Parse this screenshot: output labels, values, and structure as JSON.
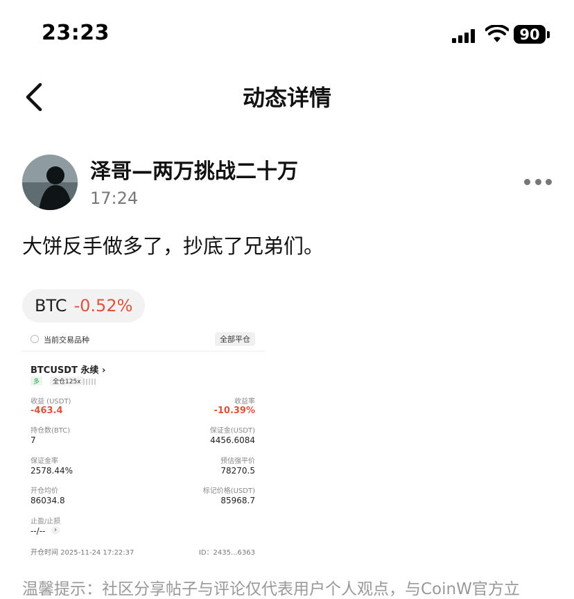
{
  "status_bar": {
    "time": "23:23",
    "battery": "90"
  },
  "nav": {
    "title": "动态详情"
  },
  "post": {
    "author": "泽哥—两万挑战二十万",
    "time": "17:24",
    "content": "大饼反手做多了，抄底了兄弟们。",
    "ticker": {
      "symbol": "BTC",
      "change": "-0.52%"
    }
  },
  "screenshot": {
    "label": "当前交易品种",
    "close_all": "全部平仓",
    "pair": "BTCUSDT 永续 ›",
    "tag_long": "多",
    "tag_cross": "全仓125x",
    "pnl_label": "收益 (USDT)",
    "pnl_value": "-463.4",
    "roi_label": "收益率",
    "roi_value": "-10.39%",
    "size_label": "持仓数(BTC)",
    "size_value": "7",
    "margin_label": "保证金(USDT)",
    "margin_value": "4456.6084",
    "margin_ratio_label": "保证金率",
    "margin_ratio_value": "2578.44%",
    "liq_label": "预估强平价",
    "liq_value": "78270.5",
    "entry_label": "开仓均价",
    "entry_value": "86034.8",
    "mark_label": "标记价格(USDT)",
    "mark_value": "85968.7",
    "tpsl_label": "止盈/止损",
    "tpsl_value": "--/--",
    "tpsl_arrow": "›",
    "open_time": "开仓时间 2025-11-24 17:22:37",
    "id": "ID：2435...6363"
  },
  "notice": "温馨提示：社区分享帖子与评论仅代表用户个人观点，与CoinW官方立"
}
